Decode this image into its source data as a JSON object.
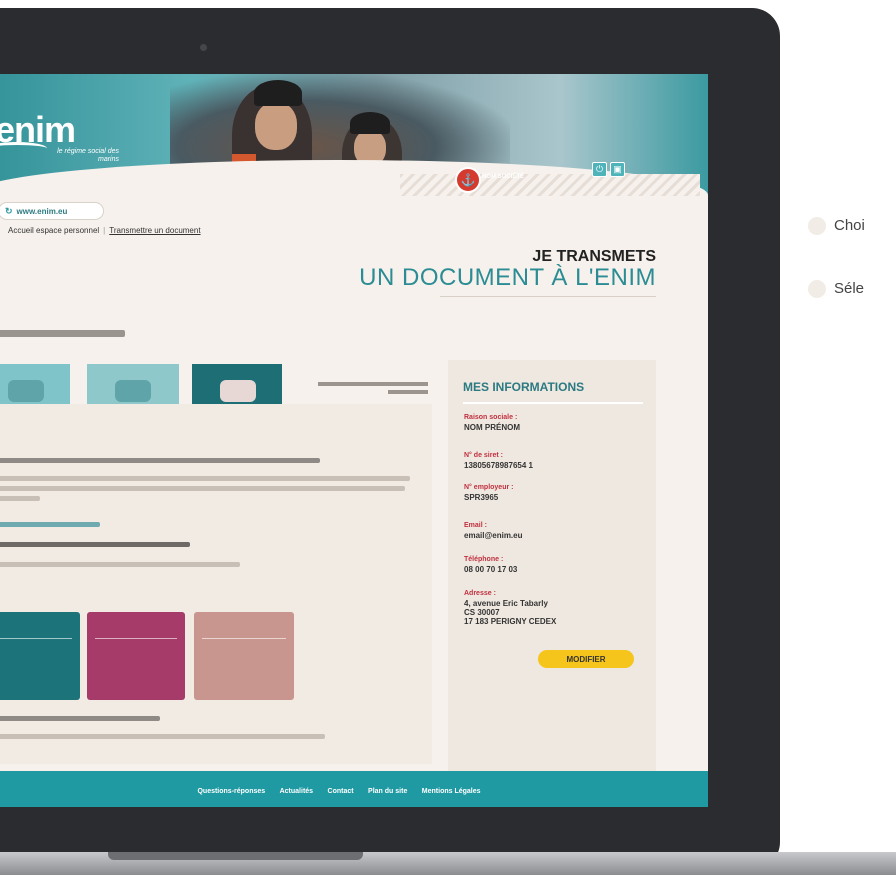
{
  "header": {
    "logo_text": "enim",
    "logo_tagline": "le régime social des marins",
    "company_name": "NOM SOCIÉTÉ"
  },
  "site_link": "www.enim.eu",
  "breadcrumb": {
    "home": "Accueil espace personnel",
    "current": "Transmettre un document"
  },
  "page_title": {
    "line1": "JE TRANSMETS",
    "line2": "UN DOCUMENT À L'ENIM"
  },
  "sidebar": {
    "title": "MES INFORMATIONS",
    "fields": [
      {
        "label": "Raison sociale :",
        "value": "NOM PRÉNOM"
      },
      {
        "label": "N° de siret :",
        "value": "13805678987654 1"
      },
      {
        "label": "N° employeur :",
        "value": "SPR3965"
      },
      {
        "label": "Email :",
        "value": "email@enim.eu"
      },
      {
        "label": "Téléphone :",
        "value": "08 00 70 17 03"
      },
      {
        "label": "Adresse :",
        "value1": "4, avenue Eric Tabarly",
        "value2": "CS 30007",
        "value3": "17 183 PERIGNY CEDEX"
      }
    ],
    "button_label": "MODIFIER"
  },
  "footer": {
    "links": [
      "Questions-réponses",
      "Actualités",
      "Contact",
      "Plan du site",
      "Mentions Légales"
    ]
  },
  "side_legend": [
    "Choi",
    "Séle"
  ],
  "colors": {
    "teal": "#1f9aa3",
    "dark_teal": "#1d737a",
    "accent_red": "#c0303f",
    "button_yellow": "#f5c51c"
  }
}
